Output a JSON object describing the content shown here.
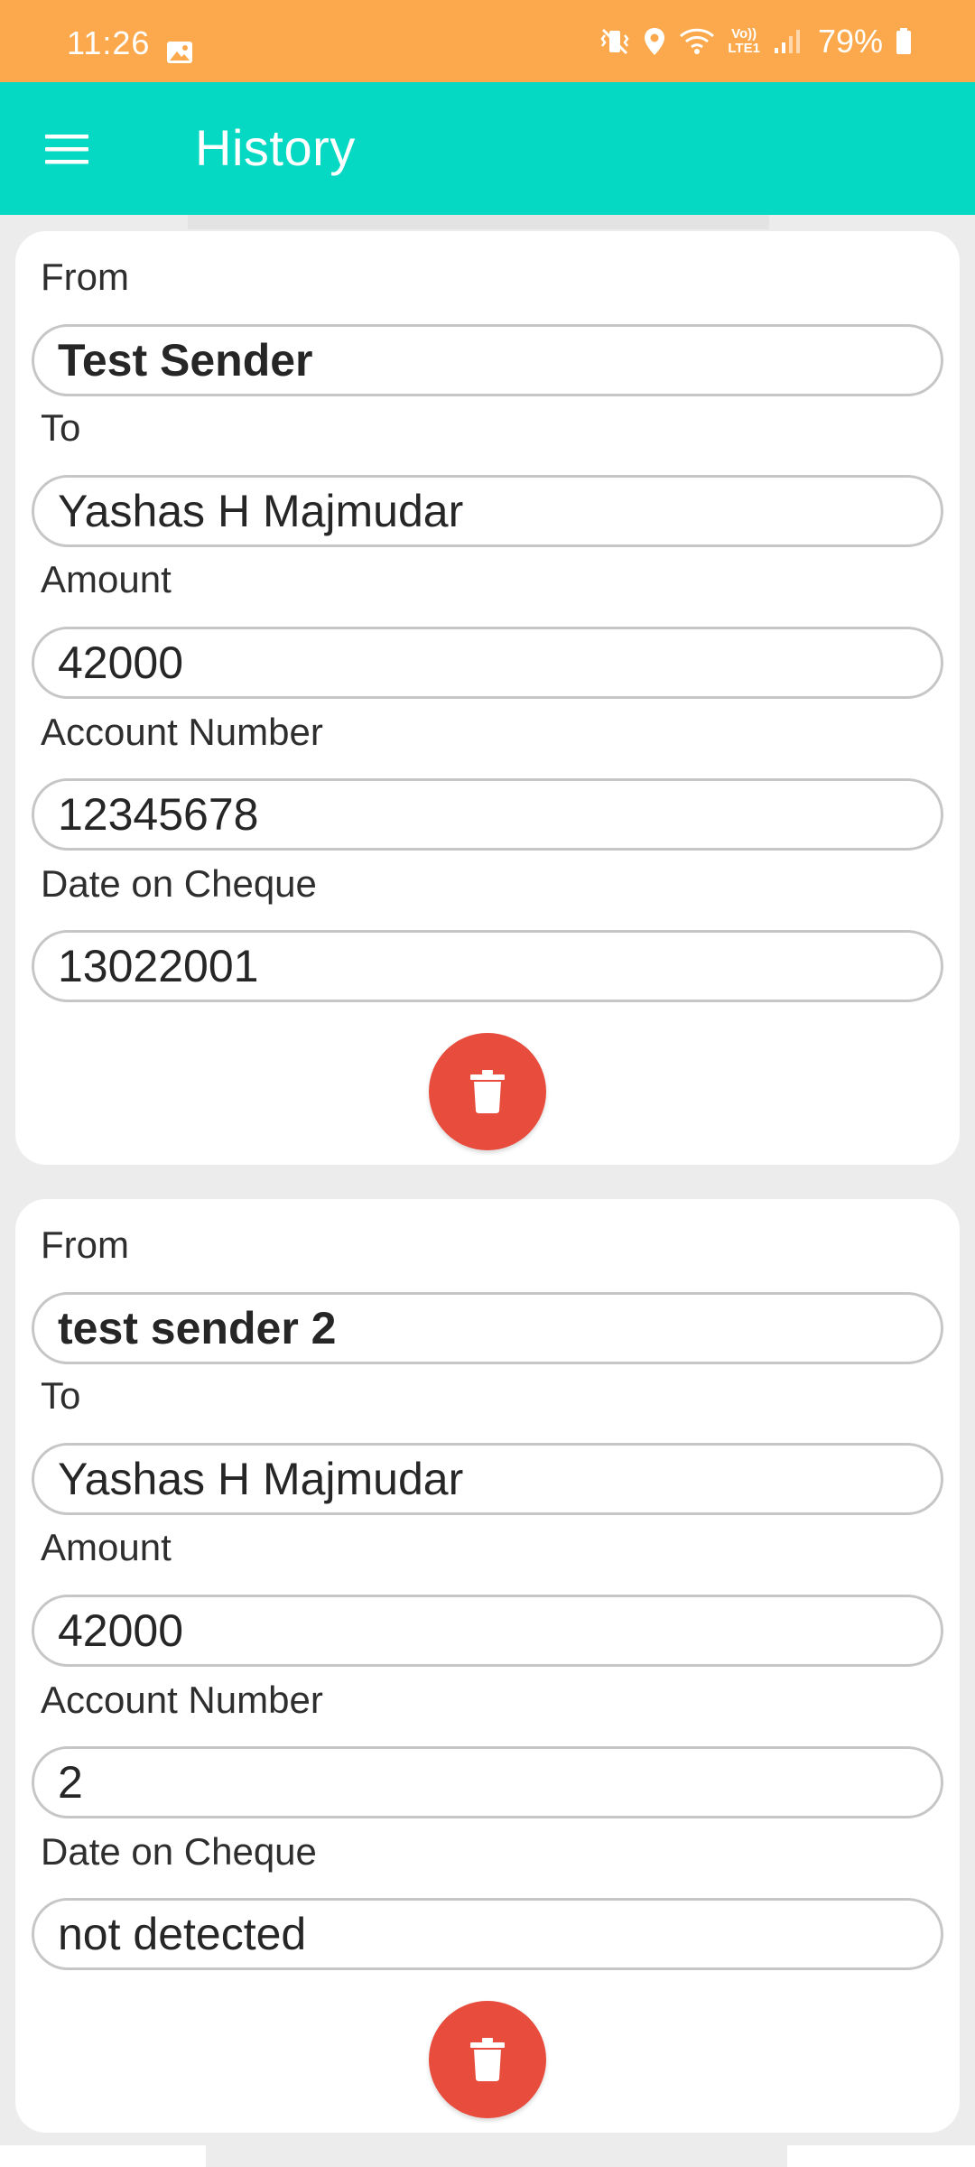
{
  "status_bar": {
    "time": "11:26",
    "battery": "79%",
    "battery_level": 0.79,
    "icons": [
      "gallery-icon",
      "vibrate-icon",
      "location-icon",
      "wifi-icon",
      "volte-icon",
      "signal-icon",
      "battery-icon"
    ],
    "volte_text": "Vo))",
    "lte_text": "LTE1"
  },
  "app_bar": {
    "title": "History",
    "menu_icon": "hamburger-menu-icon"
  },
  "colors": {
    "status_bar": "#fba94c",
    "app_bar": "#06d9c3",
    "delete_button": "#e84c3d",
    "background": "#ececec"
  },
  "records": [
    {
      "from_label": "From",
      "from_value": "Test Sender",
      "to_label": "To",
      "to_value": "Yashas H Majmudar",
      "amount_label": "Amount",
      "amount_value": "42000",
      "account_label": "Account Number",
      "account_value": "12345678",
      "date_label": "Date on Cheque",
      "date_value": "13022001",
      "delete_icon": "trash-icon"
    },
    {
      "from_label": "From",
      "from_value": "test sender 2",
      "to_label": "To",
      "to_value": "Yashas H Majmudar",
      "amount_label": "Amount",
      "amount_value": "42000",
      "account_label": "Account Number",
      "account_value": "2",
      "date_label": "Date on Cheque",
      "date_value": "not detected",
      "delete_icon": "trash-icon"
    }
  ]
}
